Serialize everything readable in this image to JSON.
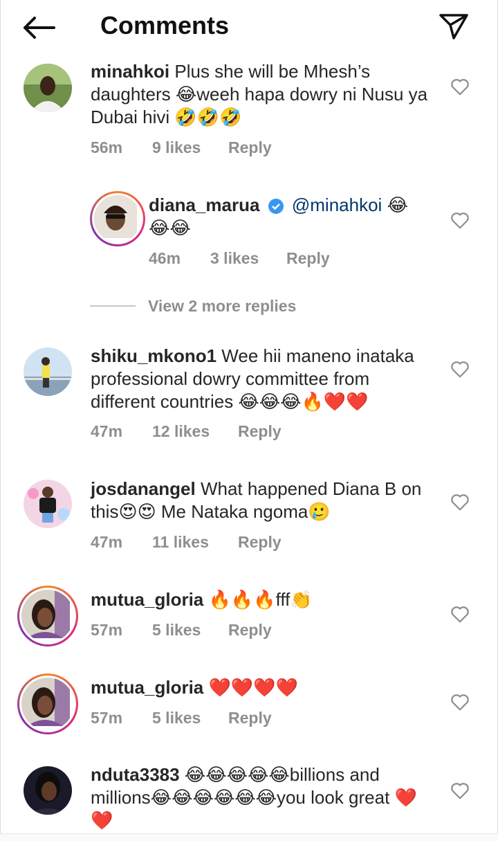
{
  "header": {
    "title": "Comments",
    "back_icon": "arrow-left-icon",
    "send_icon": "send-icon"
  },
  "comments": [
    {
      "username": "minahkoi",
      "text": "Plus she will be Mhesh’s daughters 😂weeh hapa dowry ni Nusu ya Dubai hivi 🤣🤣🤣",
      "time": "56m",
      "likes": "9 likes",
      "reply": "Reply"
    },
    {
      "username": "diana_marua",
      "verified": true,
      "mention": "@minahkoi",
      "text": " 😂😂😂",
      "time": "46m",
      "likes": "3 likes",
      "reply": "Reply"
    },
    {
      "username": "shiku_mkono1",
      "text": "Wee hii maneno  inataka professional dowry committee from different countries 😂😂😂🔥❤️❤️",
      "time": "47m",
      "likes": "12 likes",
      "reply": "Reply"
    },
    {
      "username": "josdanangel",
      "text": "What happened Diana B on this😍😍 Me Nataka ngoma🥲",
      "time": "47m",
      "likes": "11 likes",
      "reply": "Reply"
    },
    {
      "username": "mutua_gloria",
      "text": "🔥🔥🔥fff👏",
      "time": "57m",
      "likes": "5 likes",
      "reply": "Reply"
    },
    {
      "username": "mutua_gloria",
      "text": "❤️❤️❤️❤️",
      "time": "57m",
      "likes": "5 likes",
      "reply": "Reply"
    },
    {
      "username": "nduta3383",
      "text": "😂😂😂😂😂billions and millions😂😂😂😂😂😂you look great ❤️❤️"
    }
  ],
  "view_more": "View 2 more replies"
}
